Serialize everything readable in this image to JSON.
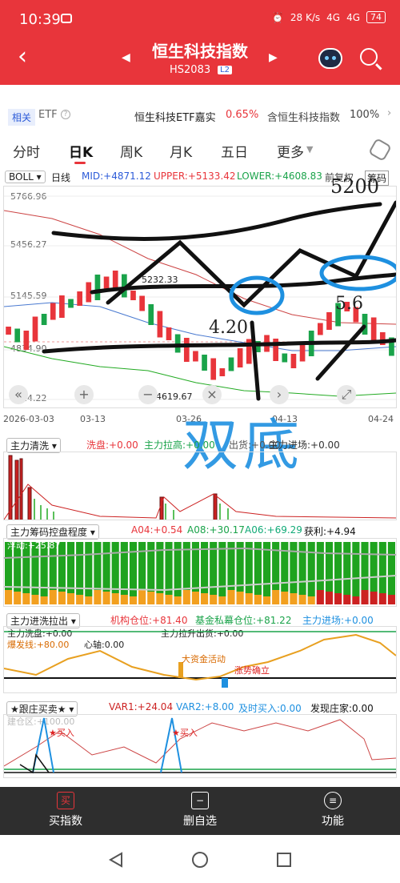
{
  "status": {
    "time": "10:39",
    "net": "28 K/s",
    "sig1": "4G",
    "sig2": "4G",
    "battery": "74"
  },
  "header": {
    "title": "恒生科技指数",
    "code": "HS2083",
    "level": "L2"
  },
  "related": {
    "tag": "相关",
    "etf": "ETF",
    "fund_name": "恒生科技ETF嘉实",
    "fund_change": "0.65%",
    "index_label": "含恒生科技指数",
    "index_pct": "100%"
  },
  "tabs": [
    "分时",
    "日K",
    "周K",
    "月K",
    "五日",
    "更多"
  ],
  "indicator": {
    "name": "BOLL",
    "period": "日线",
    "mid": "MID:+4871.12",
    "upper": "UPPER:+5133.42",
    "lower": "LOWER:+4608.83",
    "extra": "前复权",
    "extra2": "筹码"
  },
  "price_axis": [
    "5766.96",
    "5456.27",
    "5145.59",
    "4834.90",
    "4524.22"
  ],
  "chart_labels": {
    "high": "5232.33",
    "low": "4619.67"
  },
  "dates": [
    "2026-03-03",
    "03-13",
    "03-26",
    "04-13",
    "04-24"
  ],
  "handwriting": {
    "top": "5200",
    "left": "4.20",
    "right": "5.6",
    "bottom": "双底"
  },
  "panel1": {
    "name": "主力清洗",
    "v1": "洗盘:+0.00",
    "v2": "主力拉高:+0.00",
    "v3": "出货:+0.00",
    "v4": "主力进场:+0.00"
  },
  "panel2": {
    "name": "主力筹码控盘程度",
    "a04": "A04:+0.54",
    "a08": "A08:+30.17",
    "a06": "A06:+69.29",
    "profit": "获利:+4.94",
    "float": "浮动:+25.87"
  },
  "panel3": {
    "name": "主力进洗拉出",
    "inst": "机构仓位:+81.40",
    "fund": "基金私幕仓位:+81.22",
    "enter": "主力进场:+0.00",
    "wash": "主力洗盘:+0.00",
    "pull": "主力拉升出货:+0.00",
    "burst": "爆发线:+80.00",
    "axis": "心轴:0.00",
    "anno1": "大资金活动",
    "anno2": "涨势确立"
  },
  "panel4": {
    "name": "跟庄买卖",
    "var1": "VAR1:+24.04",
    "var2": "VAR2:+8.00",
    "buy": "及时买入:0.00",
    "dealer": "发现庄家:0.00",
    "build": "建仓区:+100.00",
    "mark": "买入"
  },
  "bottom": [
    {
      "label": "买指数",
      "icon": "买"
    },
    {
      "label": "删自选",
      "icon": "−"
    },
    {
      "label": "功能",
      "icon": "≡"
    }
  ],
  "colors": {
    "up": "#e8353b",
    "down": "#1aa34a",
    "accent": "#2c5bd8",
    "handwriting": "#1e90e0"
  }
}
